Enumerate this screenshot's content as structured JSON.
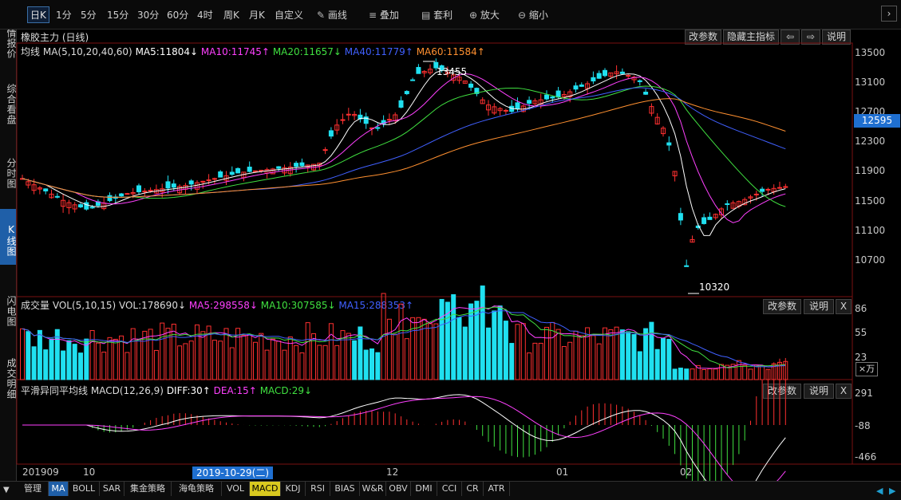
{
  "toolbar": {
    "periods": [
      "日K",
      "1分",
      "5分",
      "15分",
      "30分",
      "60分",
      "4时",
      "周K",
      "月K",
      "自定义"
    ],
    "draw_label": "画线",
    "overlay_label": "叠加",
    "arbitrage_label": "套利",
    "zoom_in_label": "放大",
    "zoom_out_label": "缩小"
  },
  "sidebar": {
    "tabs": [
      {
        "label": "行情报价",
        "active": false
      },
      {
        "label": "综合看盘",
        "active": false
      },
      {
        "label": "分时图",
        "active": false
      },
      {
        "label": "K线图",
        "active": true
      },
      {
        "label": "闪电图",
        "active": false
      },
      {
        "label": "成交明细",
        "active": false
      }
    ]
  },
  "main_panel": {
    "title": "橡胶主力 (日线)",
    "ma_header": "均线",
    "ma_params": "MA(5,10,20,40,60)",
    "ma_values": [
      {
        "text": "MA5:11804↓",
        "color": "#ffffff"
      },
      {
        "text": "MA10:11745↑",
        "color": "#ff40ff"
      },
      {
        "text": "MA20:11657↓",
        "color": "#40e040"
      },
      {
        "text": "MA40:11779↑",
        "color": "#4060ff"
      },
      {
        "text": "MA60:11584↑",
        "color": "#ff9030"
      }
    ],
    "buttons": {
      "params": "改参数",
      "hide": "隐藏主指标",
      "explain": "说明"
    },
    "y_ticks": [
      "13500",
      "13100",
      "12700",
      "12300",
      "11900",
      "11500",
      "11100",
      "10700"
    ],
    "current_price": "12595",
    "high_label": "13455",
    "low_label": "10320"
  },
  "volume_panel": {
    "header": "成交量",
    "params": "VOL(5,10,15)",
    "vol": "VOL:178690↓",
    "ma5": "MA5:298558↓",
    "ma10": "MA10:307585↓",
    "ma15": "MA15:288353↑",
    "buttons": {
      "params": "改参数",
      "explain": "说明",
      "close": "X"
    },
    "y_ticks": [
      "86",
      "55",
      "23"
    ],
    "unit": "×万"
  },
  "macd_panel": {
    "header": "平滑异同平均线",
    "params": "MACD(12,26,9)",
    "diff": "DIFF:30↑",
    "dea": "DEA:15↑",
    "macd": "MACD:29↓",
    "buttons": {
      "params": "改参数",
      "explain": "说明",
      "close": "X"
    },
    "y_ticks": [
      "291",
      "-88",
      "-466"
    ]
  },
  "x_axis": {
    "labels": [
      "201909",
      "10",
      "12",
      "01",
      "02"
    ],
    "cursor_date": "2019-10-29(二)"
  },
  "bottom_tabs": {
    "manage": "管理",
    "items": [
      "MA",
      "BOLL",
      "SAR",
      "集金策略",
      "海龟策略",
      "VOL",
      "MACD",
      "KDJ",
      "RSI",
      "BIAS",
      "W&R",
      "OBV",
      "DMI",
      "CCI",
      "CR",
      "ATR"
    ]
  },
  "colors": {
    "up": "#ff3030",
    "down": "#20e0f0",
    "accent": "#1f5fa8",
    "bg": "#000000"
  }
}
